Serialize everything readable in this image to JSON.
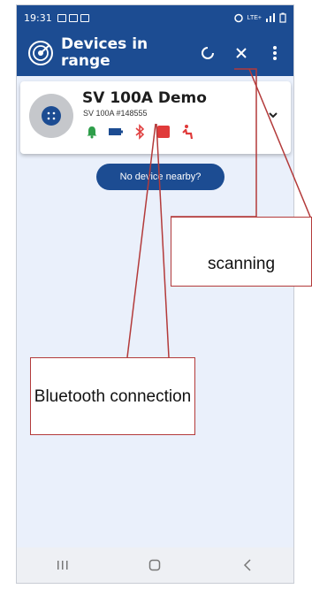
{
  "status_bar": {
    "time": "19:31",
    "right_text": "LTE+"
  },
  "app_bar": {
    "title": "Devices in range",
    "logo_icon": "radar-icon",
    "actions": [
      "refresh-spinner-icon",
      "close-icon",
      "more-vert-icon"
    ]
  },
  "device": {
    "name": "SV 100A Demo",
    "subtitle": "SV 100A #148555",
    "status_icons": [
      {
        "name": "bell-icon",
        "color": "#2e9e4a"
      },
      {
        "name": "battery-icon",
        "color": "#1c4c92"
      },
      {
        "name": "bluetooth-icon",
        "color": "#e04040"
      },
      {
        "name": "stop-square-icon",
        "color": "#e03a3a"
      },
      {
        "name": "person-seated-icon",
        "color": "#e03a3a"
      }
    ]
  },
  "buttons": {
    "no_device": "No device nearby?"
  },
  "callouts": {
    "scanning": "scanning",
    "bluetooth": "Bluetooth connection"
  },
  "colors": {
    "primary": "#1c4c92",
    "background": "#eaf0fb",
    "callout_line": "#b33a3a"
  }
}
